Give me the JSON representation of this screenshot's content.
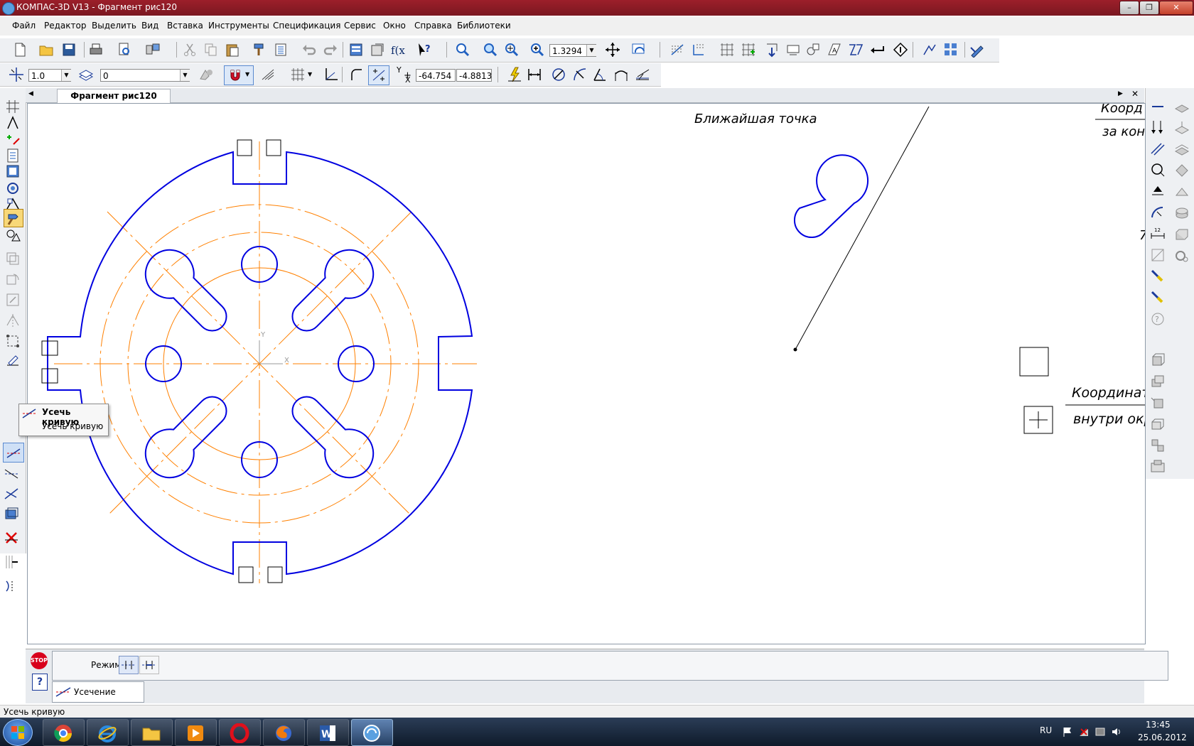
{
  "window": {
    "title": "КОМПАС-3D V13 - Фрагмент рис120",
    "controls": {
      "minimize": "–",
      "restore": "❐",
      "close": "✕"
    }
  },
  "menu": [
    "Файл",
    "Редактор",
    "Выделить",
    "Вид",
    "Вставка",
    "Инструменты",
    "Спецификация",
    "Сервис",
    "Окно",
    "Справка",
    "Библиотеки"
  ],
  "toolbar": {
    "zoom_value": "1.3294",
    "step_value": "1.0",
    "layer_value": "0",
    "coord_x_label": "X",
    "coord_y_label": "Y",
    "coord_x_value": "-64.754",
    "coord_y_value": "-4.8813"
  },
  "document": {
    "tab": "Фрагмент рис120"
  },
  "drawing": {
    "texts": [
      "Ближайшая точка",
      "Коорд",
      "за кон",
      "Координат",
      "внутри окр",
      "7"
    ],
    "axis_x": "X",
    "axis_y": "Y"
  },
  "tooltip": {
    "title": "Усечь кривую",
    "description": "Усечь кривую"
  },
  "properties": {
    "mode_label": "Режим",
    "tab_label": "Усечение",
    "stop_label": "STOP",
    "help_label": "?"
  },
  "status": {
    "text": "Усечь кривую"
  },
  "taskbar": {
    "language": "RU",
    "time": "13:45",
    "date": "25.06.2012"
  },
  "colors": {
    "contour": "#0000e0",
    "axis": "#ff8000",
    "title_bar": "#8b1a24"
  }
}
